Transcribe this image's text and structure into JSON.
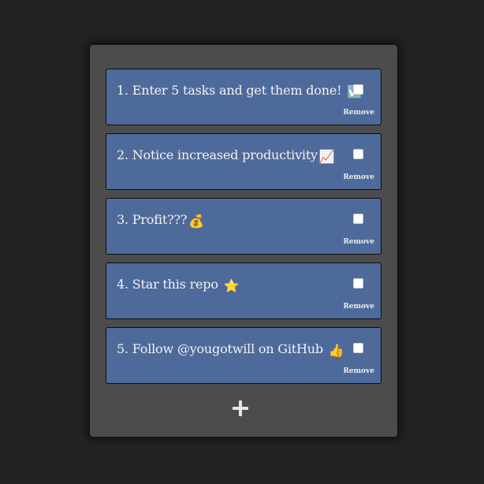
{
  "tasks": [
    {
      "text": "1. Enter 5 tasks and get them done!",
      "emoji": "☑️",
      "emoji_name": "check-box-icon",
      "checked": false,
      "remove_label": "Remove"
    },
    {
      "text": "2. Notice increased productivity",
      "emoji": "📈",
      "emoji_name": "chart-increasing-icon",
      "checked": false,
      "remove_label": "Remove"
    },
    {
      "text": "3. Profit???",
      "emoji": "💰",
      "emoji_name": "money-bag-icon",
      "checked": false,
      "remove_label": "Remove"
    },
    {
      "text": "4. Star this repo",
      "emoji": "⭐",
      "emoji_name": "star-icon",
      "checked": false,
      "remove_label": "Remove"
    },
    {
      "text": "5. Follow @yougotwill on GitHub",
      "emoji": "👍",
      "emoji_name": "thumbs-up-icon",
      "checked": false,
      "remove_label": "Remove"
    }
  ],
  "add_button": {
    "icon": "plus-icon"
  },
  "colors": {
    "page_background": "#222222",
    "panel_background": "#4c4c4c",
    "task_background": "#4e6a9a",
    "text": "#f2f2f2"
  }
}
